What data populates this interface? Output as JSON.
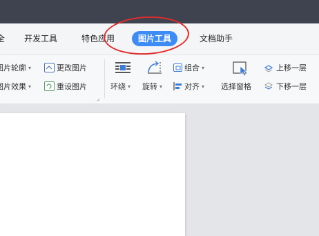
{
  "tabs": {
    "partial_left": "全",
    "developer": "开发工具",
    "special": "特色应用",
    "picture_tools": "图片工具",
    "doc_helper": "文档助手"
  },
  "ribbon": {
    "outline": "图片轮廓",
    "effects": "图片效果",
    "change_picture": "更改图片",
    "reset_picture": "重设图片",
    "wrap": "环绕",
    "rotate": "旋转",
    "group": "组合",
    "align": "对齐",
    "selection_pane": "选择窗格",
    "bring_forward": "上移一层",
    "send_backward": "下移一层"
  },
  "colors": {
    "title_bar": "#3f4350",
    "active_tab": "#3d8cf5",
    "highlight_ring": "#e22c2c"
  }
}
